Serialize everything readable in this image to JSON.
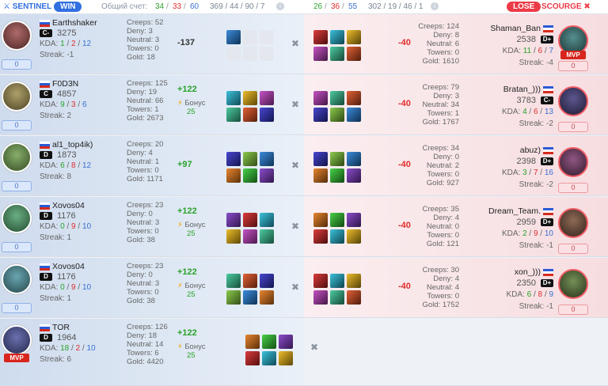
{
  "header": {
    "sentinel": "SENTINEL",
    "win": "WIN",
    "score_label": "Общий счет:",
    "s_kills": "34",
    "sep1": "/",
    "s_deaths": "33",
    "sep2": "/",
    "s_assists": "60",
    "s_farm": "369 / 44 / 90 / 7",
    "info": "i",
    "d_kills": "26",
    "d_deaths": "36",
    "d_assists": "55",
    "d_farm": "302 / 19 / 46 / 1",
    "lose": "LOSE",
    "scourge": "SCOURGE"
  },
  "colors": {
    "win": "#2f6fe0",
    "lose": "#ec3b47",
    "kills": "#2aa32a",
    "deaths": "#e12d2d",
    "assists": "#3a6fd0"
  },
  "rows": [
    {
      "l": {
        "name": "Earthshaker",
        "tag": "C-",
        "rating": "3275",
        "k": "1",
        "d": "2",
        "a": "12",
        "streak": "Streak: -1",
        "box": "0",
        "mvp": "",
        "creeps": "Creeps: 52",
        "deny": "Deny: 3",
        "neutral": "Neutral: 3",
        "towers": "Towers: 0",
        "gold": "Gold: 18",
        "delta": "-137",
        "bonus": "",
        "bonusVal": ""
      },
      "r": {
        "name": "Shaman_Ban",
        "tag": "D+",
        "rating": "2538",
        "k": "11",
        "d": "6",
        "a": "7",
        "streak": "Streak: -4",
        "box": "0",
        "mvp": "MVP",
        "creeps": "Creeps: 124",
        "deny": "Deny: 8",
        "neutral": "Neutral: 6",
        "towers": "Towers: 0",
        "gold": "Gold: 1610",
        "delta": "-40"
      }
    },
    {
      "l": {
        "name": "F0D3N",
        "tag": "C",
        "rating": "4857",
        "k": "9",
        "d": "3",
        "a": "6",
        "streak": "Streak: 2",
        "box": "0",
        "mvp": "",
        "creeps": "Creeps: 125",
        "deny": "Deny: 19",
        "neutral": "Neutral: 66",
        "towers": "Towers: 1",
        "gold": "Gold: 2673",
        "delta": "+122",
        "bonus": "Бонус",
        "bonusVal": "25"
      },
      "r": {
        "name": "Bratan_)))",
        "tag": "C-",
        "rating": "3783",
        "k": "4",
        "d": "6",
        "a": "13",
        "streak": "Streak: -2",
        "box": "0",
        "mvp": "",
        "creeps": "Creeps: 79",
        "deny": "Deny: 3",
        "neutral": "Neutral: 34",
        "towers": "Towers: 1",
        "gold": "Gold: 1767",
        "delta": "-40"
      }
    },
    {
      "l": {
        "name": "al1_top4ik)",
        "tag": "D",
        "rating": "1873",
        "k": "6",
        "d": "8",
        "a": "12",
        "streak": "Streak: 8",
        "box": "0",
        "mvp": "",
        "creeps": "Creeps: 20",
        "deny": "Deny: 4",
        "neutral": "Neutral: 1",
        "towers": "Towers: 0",
        "gold": "Gold: 1171",
        "delta": "+97",
        "bonus": "",
        "bonusVal": ""
      },
      "r": {
        "name": "abuz)",
        "tag": "D+",
        "rating": "2398",
        "k": "3",
        "d": "7",
        "a": "16",
        "streak": "Streak: -2",
        "box": "0",
        "mvp": "",
        "creeps": "Creeps: 34",
        "deny": "Deny: 0",
        "neutral": "Neutral: 2",
        "towers": "Towers: 0",
        "gold": "Gold: 927",
        "delta": "-40"
      }
    },
    {
      "l": {
        "name": "Xovos04",
        "tag": "D",
        "rating": "1176",
        "k": "0",
        "d": "9",
        "a": "10",
        "streak": "Streak: 1",
        "box": "0",
        "mvp": "",
        "creeps": "Creeps: 23",
        "deny": "Deny: 0",
        "neutral": "Neutral: 3",
        "towers": "Towers: 0",
        "gold": "Gold: 38",
        "delta": "+122",
        "bonus": "Бонус",
        "bonusVal": "25"
      },
      "r": {
        "name": "Dream_Team.",
        "tag": "D+",
        "rating": "2959",
        "k": "2",
        "d": "9",
        "a": "10",
        "streak": "Streak: -1",
        "box": "0",
        "mvp": "",
        "creeps": "Creeps: 35",
        "deny": "Deny: 4",
        "neutral": "Neutral: 0",
        "towers": "Towers: 0",
        "gold": "Gold: 121",
        "delta": "-40"
      }
    },
    {
      "l": {
        "name": "Xovos04",
        "tag": "D",
        "rating": "1176",
        "k": "0",
        "d": "9",
        "a": "10",
        "streak": "Streak: 1",
        "box": "0",
        "mvp": "",
        "creeps": "Creeps: 23",
        "deny": "Deny: 0",
        "neutral": "Neutral: 3",
        "towers": "Towers: 0",
        "gold": "Gold: 38",
        "delta": "+122",
        "bonus": "Бонус",
        "bonusVal": "25"
      },
      "r": {
        "name": "xon_)))",
        "tag": "D+",
        "rating": "2350",
        "k": "6",
        "d": "8",
        "a": "9",
        "streak": "Streak: -1",
        "box": "0",
        "mvp": "",
        "creeps": "Creeps: 30",
        "deny": "Deny: 4",
        "neutral": "Neutral: 4",
        "towers": "Towers: 0",
        "gold": "Gold: 1752",
        "delta": "-40"
      }
    },
    {
      "l": {
        "name": "TOR",
        "tag": "D",
        "rating": "1964",
        "k": "18",
        "d": "2",
        "a": "10",
        "streak": "Streak: 6",
        "box": "",
        "mvp": "MVP",
        "creeps": "Creeps: 126",
        "deny": "Deny: 18",
        "neutral": "Neutral: 14",
        "towers": "Towers: 6",
        "gold": "Gold: 4420",
        "delta": "+122",
        "bonus": "Бонус",
        "bonusVal": "25"
      },
      "r": null
    }
  ]
}
